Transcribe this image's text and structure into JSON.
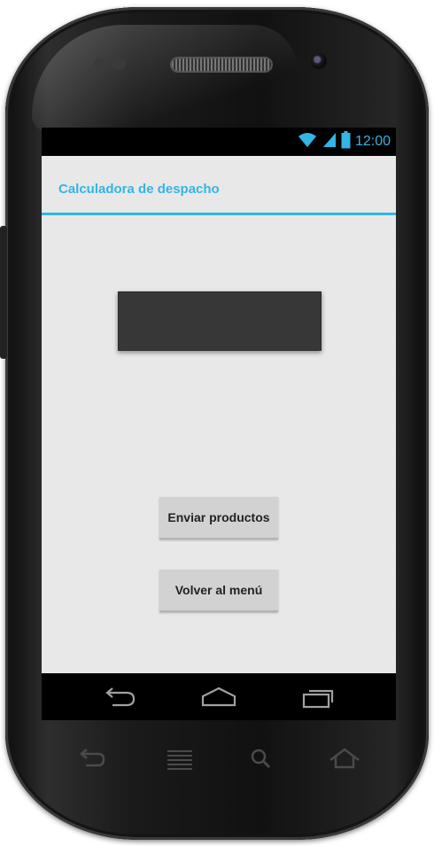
{
  "status_bar": {
    "time": "12:00",
    "icons": [
      "wifi-icon",
      "signal-icon",
      "battery-icon"
    ],
    "accent_color": "#33b5e5"
  },
  "action_bar": {
    "title": "Calculadora de despacho",
    "accent_color": "#33b5e5"
  },
  "main": {
    "display_box_color": "#373737",
    "buttons": {
      "send_label": "Enviar productos",
      "back_label": "Volver al menú"
    }
  },
  "navigation_bar": {
    "items": [
      "back-icon",
      "home-icon",
      "recent-apps-icon"
    ]
  },
  "hardware_keys": {
    "items": [
      "back-icon",
      "menu-icon",
      "search-icon",
      "home-icon"
    ]
  }
}
